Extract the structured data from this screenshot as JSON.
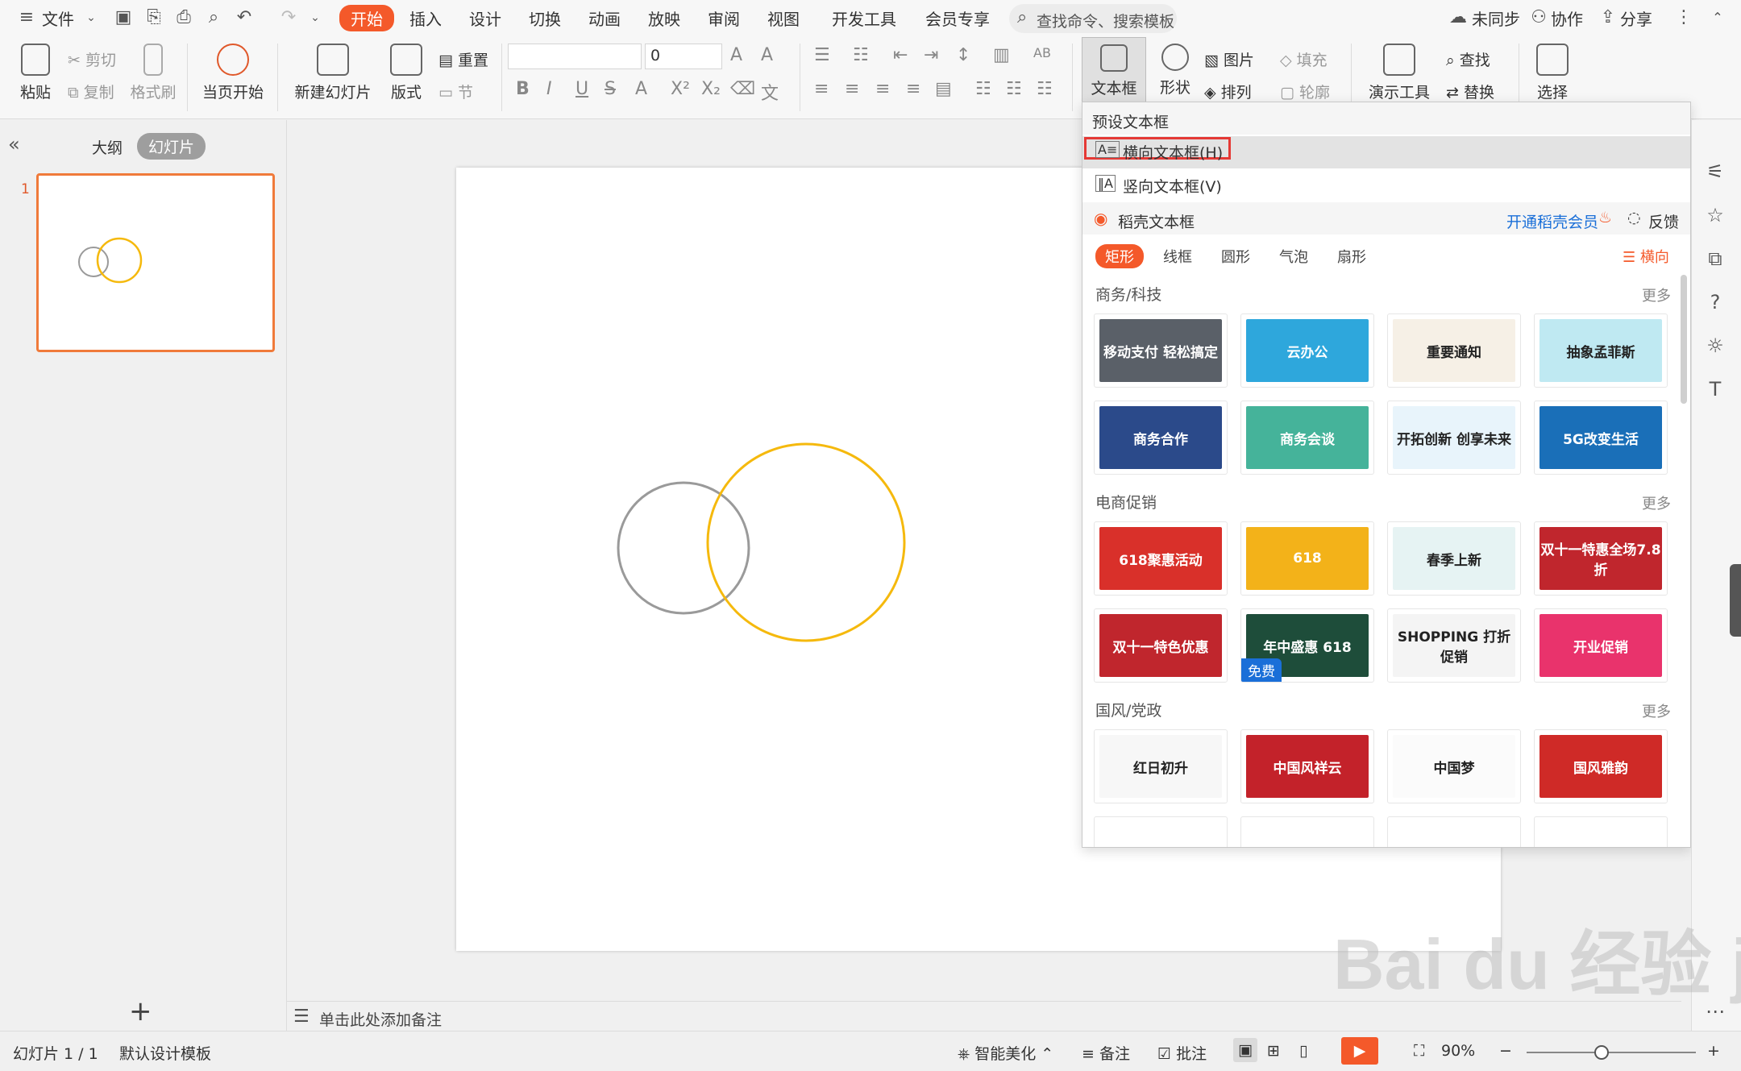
{
  "menu": {
    "file": "文件",
    "tabs": [
      "开始",
      "插入",
      "设计",
      "切换",
      "动画",
      "放映",
      "审阅",
      "视图",
      "开发工具",
      "会员专享"
    ],
    "active_tab": "开始",
    "search_placeholder": "查找命令、搜索模板",
    "sync": "未同步",
    "collab": "协作",
    "share": "分享"
  },
  "ribbon": {
    "paste": "粘贴",
    "cut": "剪切",
    "copy": "复制",
    "format_painter": "格式刷",
    "from_current": "当页开始",
    "new_slide": "新建幻灯片",
    "layout": "版式",
    "reset": "重置",
    "section": "节",
    "font_size": "0",
    "textbox": "文本框",
    "shape": "形状",
    "picture": "图片",
    "fill": "填充",
    "arrange": "排列",
    "outline": "轮廓",
    "present_tools": "演示工具",
    "find": "查找",
    "replace": "替换",
    "select": "选择"
  },
  "left_panel": {
    "outline_tab": "大纲",
    "slides_tab": "幻灯片",
    "slide_number": "1"
  },
  "notes_placeholder": "单击此处添加备注",
  "dropdown": {
    "preset_title": "预设文本框",
    "horizontal": "横向文本框(H)",
    "vertical": "竖向文本框(V)",
    "daoke": "稻壳文本框",
    "membership": "开通稻壳会员",
    "feedback": "反馈",
    "chips": [
      "矩形",
      "线框",
      "圆形",
      "气泡",
      "扇形"
    ],
    "orientation": "横向",
    "more": "更多",
    "sections": [
      {
        "title": "商务/科技",
        "items": [
          {
            "text": "移动支付 轻松搞定",
            "color": "#5a6068"
          },
          {
            "text": "云办公",
            "color": "#2ea7dc"
          },
          {
            "text": "重要通知",
            "color": "#f6f0e6"
          },
          {
            "text": "抽象孟菲斯",
            "color": "#bfe9f2"
          },
          {
            "text": "商务合作",
            "color": "#2b4a8a"
          },
          {
            "text": "商务会谈",
            "color": "#45b39a"
          },
          {
            "text": "开拓创新 创享未来",
            "color": "#e8f4fb"
          },
          {
            "text": "5G改变生活",
            "color": "#1a6fb8"
          }
        ]
      },
      {
        "title": "电商促销",
        "items": [
          {
            "text": "618聚惠活动",
            "color": "#d9302a"
          },
          {
            "text": "618",
            "color": "#f3b219"
          },
          {
            "text": "春季上新",
            "color": "#e6f3f3"
          },
          {
            "text": "双十一特惠全场7.8折",
            "color": "#c0262d"
          },
          {
            "text": "双十一特色优惠",
            "color": "#c0262d"
          },
          {
            "text": "年中盛惠 618",
            "color": "#1e4d3a"
          },
          {
            "text": "SHOPPING 打折促销",
            "color": "#f4f4f4"
          },
          {
            "text": "开业促销",
            "color": "#e9336c"
          }
        ]
      },
      {
        "title": "国风/党政",
        "items": [
          {
            "text": "红日初升",
            "color": "#f7f7f7"
          },
          {
            "text": "中国风祥云",
            "color": "#c3222a"
          },
          {
            "text": "中国梦",
            "color": "#fbfbfb"
          },
          {
            "text": "国风雅韵",
            "color": "#cf2a27"
          }
        ]
      }
    ],
    "free_badge": "免费"
  },
  "status": {
    "slide_info": "幻灯片 1 / 1",
    "template": "默认设计模板",
    "beautify": "智能美化",
    "notes": "备注",
    "comments": "批注",
    "zoom": "90%"
  },
  "colors": {
    "accent": "#f4592a",
    "circle_gray": "#9a9a9a",
    "circle_yellow": "#f5b90d",
    "highlight_box": "#e53935"
  },
  "watermark": "Bai du 经验 jingyan.baidu.com"
}
